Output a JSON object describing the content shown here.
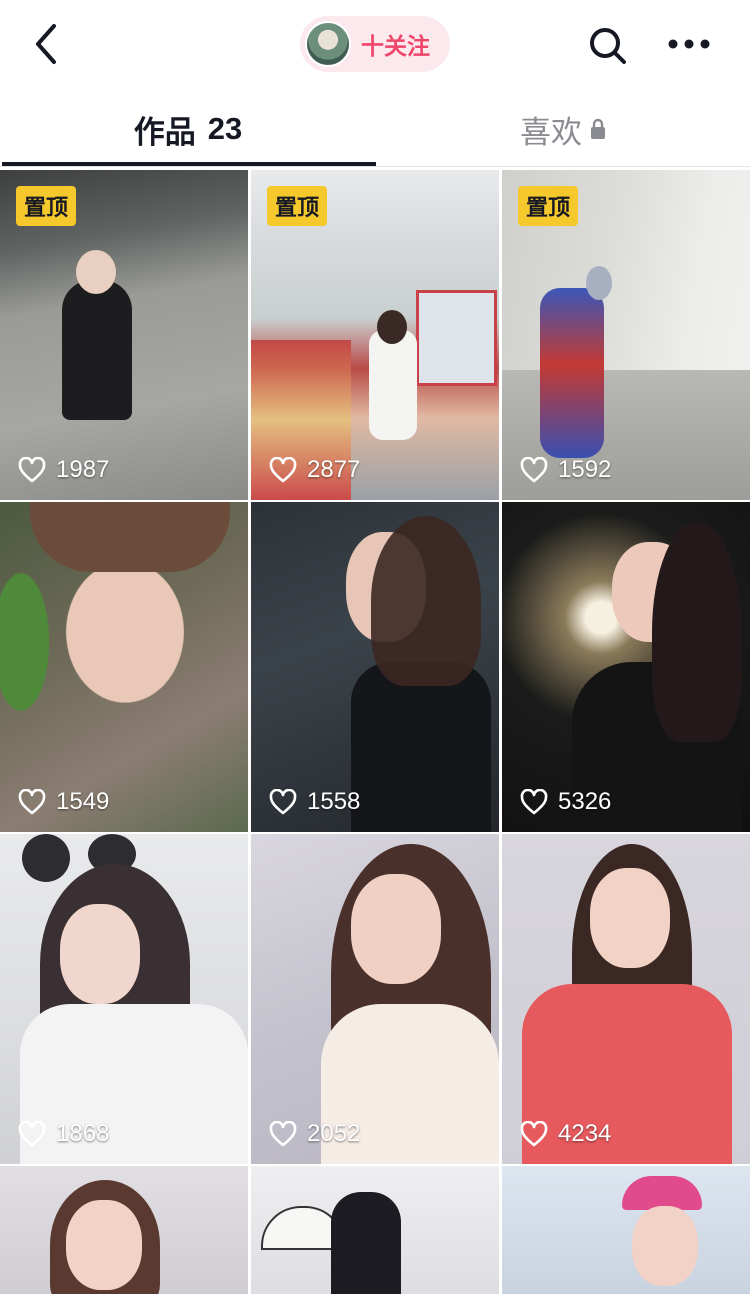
{
  "header": {
    "follow_label": "十关注"
  },
  "tabs": [
    {
      "label": "作品",
      "count": "23"
    },
    {
      "label": "喜欢"
    }
  ],
  "grid": {
    "items": [
      {
        "likes": "1987",
        "pinned": true
      },
      {
        "likes": "2877",
        "pinned": true
      },
      {
        "likes": "1592",
        "pinned": true
      },
      {
        "likes": "1549",
        "pinned": false
      },
      {
        "likes": "1558",
        "pinned": false
      },
      {
        "likes": "5326",
        "pinned": false
      },
      {
        "likes": "1868",
        "pinned": false
      },
      {
        "likes": "2052",
        "pinned": false
      },
      {
        "likes": "4234",
        "pinned": false
      },
      {
        "likes": "",
        "pinned": false
      },
      {
        "likes": "",
        "pinned": false
      },
      {
        "likes": "",
        "pinned": false
      }
    ],
    "pin_label": "置顶"
  },
  "colors": {
    "accent": "#f0466a",
    "pin_badge": "#f5c92b",
    "text_primary": "#161823",
    "text_secondary": "#8a8b91"
  },
  "icons": [
    "back-arrow-icon",
    "search-icon",
    "more-icon",
    "lock-icon",
    "heart-icon",
    "plus-icon"
  ]
}
